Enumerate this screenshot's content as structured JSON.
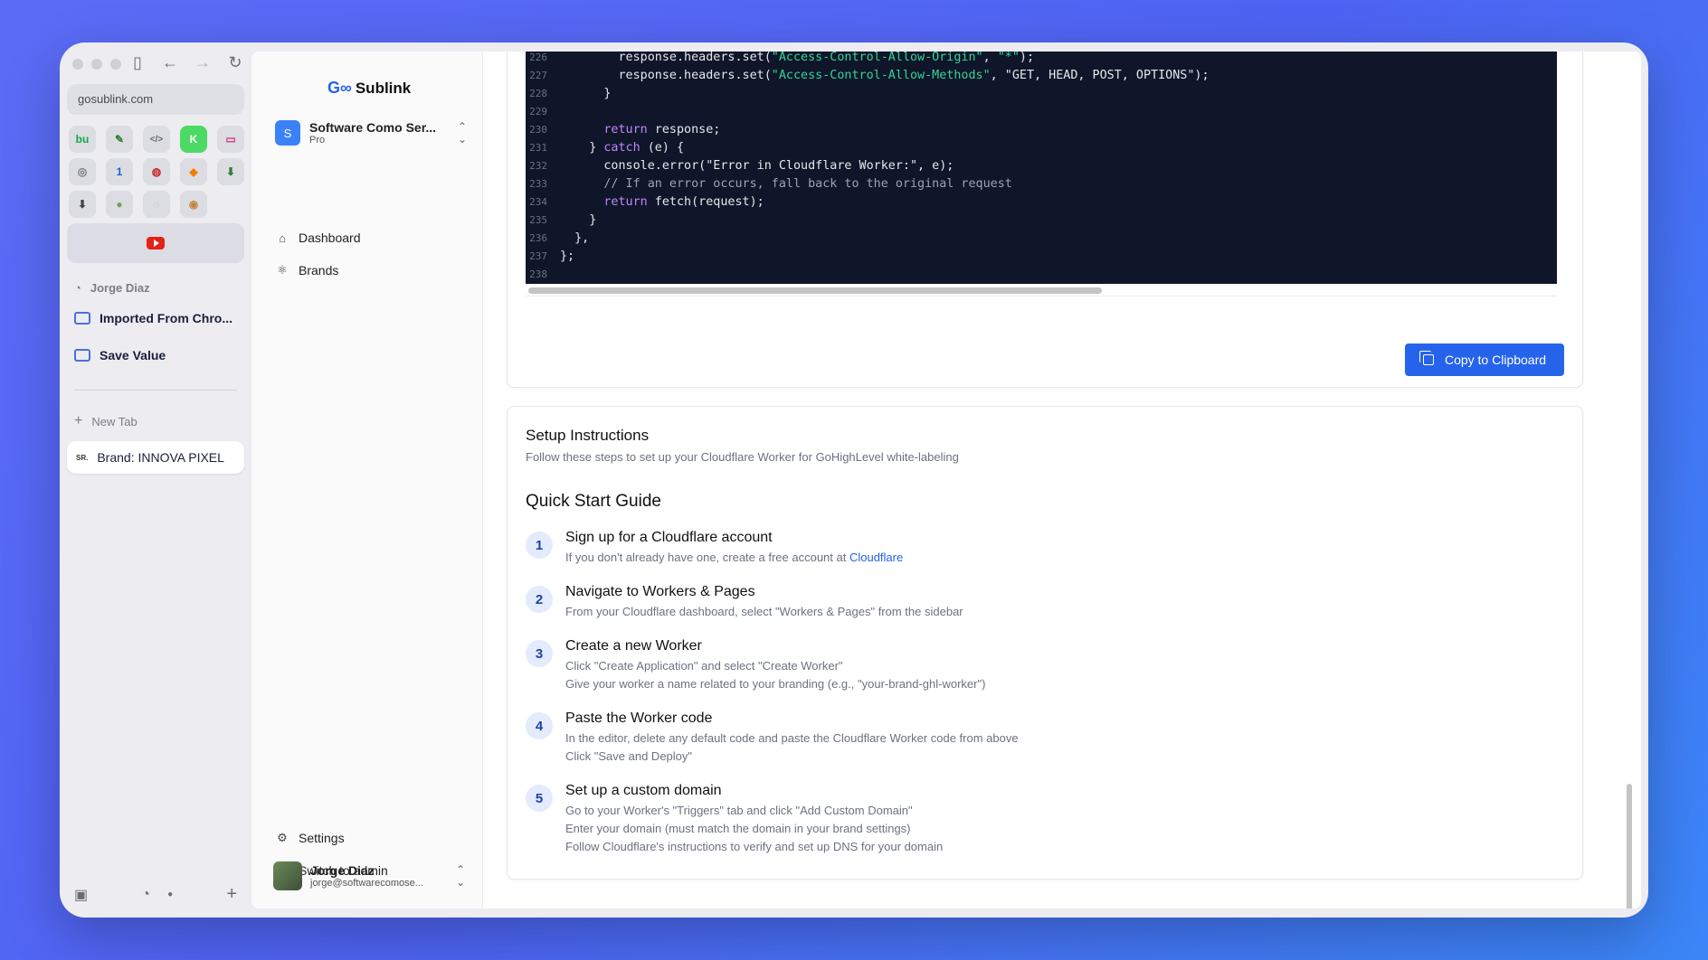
{
  "browser": {
    "url": "gosublink.com",
    "favicons": [
      "bu",
      "✎",
      "</>",
      "K",
      "▭",
      "◎",
      "1",
      "◍",
      "◆",
      "⬇",
      "⬇",
      "●",
      "◌",
      "◉"
    ],
    "profile_name": "Jorge Diaz",
    "folders": [
      "Imported From Chro...",
      "Save Value"
    ],
    "new_tab_label": "New Tab",
    "active_tab_label": "Brand: INNOVA PIXEL",
    "active_tab_prefix": "SR."
  },
  "app": {
    "logo_mark": "G∞",
    "logo_text": "Sublink",
    "org": {
      "initial": "S",
      "name": "Software Como Ser...",
      "plan": "Pro"
    },
    "nav": [
      {
        "label": "Dashboard",
        "icon": "home-icon"
      },
      {
        "label": "Brands",
        "icon": "atom-icon"
      }
    ],
    "bottom_nav": [
      {
        "label": "Settings",
        "icon": "gear-icon"
      },
      {
        "label": "Switch to admin",
        "icon": "user-cog-icon"
      }
    ],
    "user": {
      "name": "Jorge Diaz",
      "email": "jorge@softwarecomose..."
    }
  },
  "code_block": {
    "lines": [
      {
        "n": "226",
        "html": "        response.headers.set(<span class=\"str\">\"Access-Control-Allow-Origin\"</span>, <span class=\"str\">\"*\"</span>);"
      },
      {
        "n": "227",
        "html": "        response.headers.set(<span class=\"str\">\"Access-Control-Allow-Methods\"</span>, \"GET, HEAD, POST, OPTIONS\");"
      },
      {
        "n": "228",
        "html": "      }"
      },
      {
        "n": "229",
        "html": ""
      },
      {
        "n": "230",
        "html": "      <span class=\"kw\">return</span> response;"
      },
      {
        "n": "231",
        "html": "    } <span class=\"kw\">catch</span> (e) {"
      },
      {
        "n": "232",
        "html": "      console.error(\"Error in Cloudflare Worker:\", e);"
      },
      {
        "n": "233",
        "html": "      <span class=\"cm\">// If an error occurs, fall back to the original request</span>"
      },
      {
        "n": "234",
        "html": "      <span class=\"kw\">return</span> fetch(request);"
      },
      {
        "n": "235",
        "html": "    }"
      },
      {
        "n": "236",
        "html": "  },"
      },
      {
        "n": "237",
        "html": "};"
      },
      {
        "n": "238",
        "html": ""
      }
    ],
    "copy_label": "Copy to Clipboard"
  },
  "setup": {
    "title": "Setup Instructions",
    "description": "Follow these steps to set up your Cloudflare Worker for GoHighLevel white-labeling",
    "guide_title": "Quick Start Guide",
    "steps": [
      {
        "num": "1",
        "title": "Sign up for a Cloudflare account",
        "lines": [
          "If you don't already have one, create a free account at "
        ],
        "link": "Cloudflare"
      },
      {
        "num": "2",
        "title": "Navigate to Workers & Pages",
        "lines": [
          "From your Cloudflare dashboard, select \"Workers & Pages\" from the sidebar"
        ]
      },
      {
        "num": "3",
        "title": "Create a new Worker",
        "lines": [
          "Click \"Create Application\" and select \"Create Worker\"",
          "Give your worker a name related to your branding (e.g., \"your-brand-ghl-worker\")"
        ]
      },
      {
        "num": "4",
        "title": "Paste the Worker code",
        "lines": [
          "In the editor, delete any default code and paste the Cloudflare Worker code from above",
          "Click \"Save and Deploy\""
        ]
      },
      {
        "num": "5",
        "title": "Set up a custom domain",
        "lines": [
          "Go to your Worker's \"Triggers\" tab and click \"Add Custom Domain\"",
          "Enter your domain (must match the domain in your brand settings)",
          "Follow Cloudflare's instructions to verify and set up DNS for your domain"
        ]
      }
    ]
  }
}
